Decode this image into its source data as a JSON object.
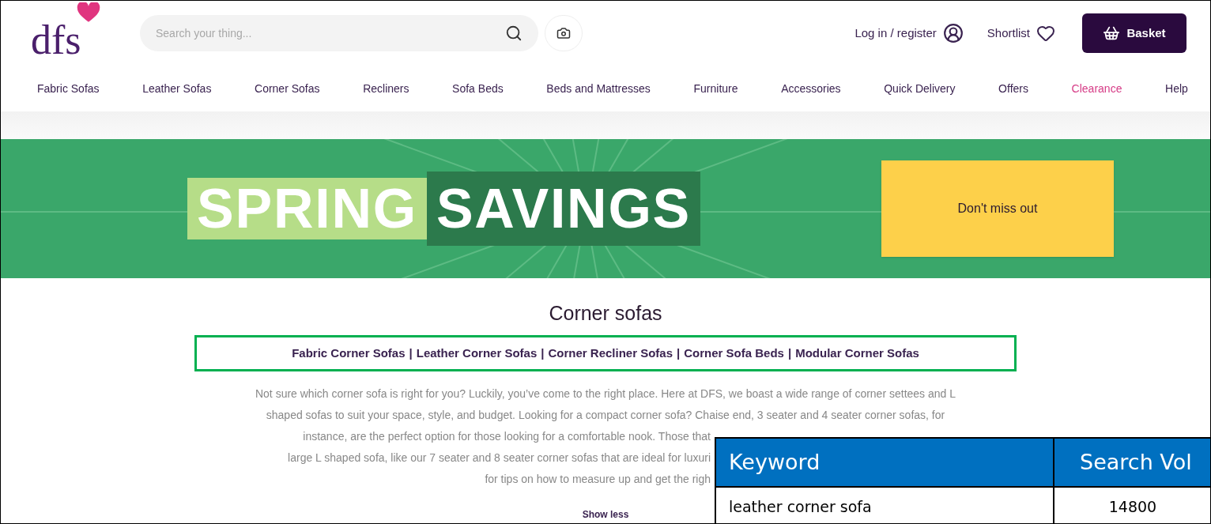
{
  "header": {
    "logo": "dfs",
    "search": {
      "placeholder": "Search your thing..."
    },
    "login": "Log in / register",
    "shortlist": "Shortlist",
    "basket": "Basket"
  },
  "nav": [
    {
      "label": "Fabric Sofas",
      "kind": "normal"
    },
    {
      "label": "Leather Sofas",
      "kind": "normal"
    },
    {
      "label": "Corner Sofas",
      "kind": "normal"
    },
    {
      "label": "Recliners",
      "kind": "normal"
    },
    {
      "label": "Sofa Beds",
      "kind": "normal"
    },
    {
      "label": "Beds and Mattresses",
      "kind": "normal"
    },
    {
      "label": "Furniture",
      "kind": "normal"
    },
    {
      "label": "Accessories",
      "kind": "normal"
    },
    {
      "label": "Quick Delivery",
      "kind": "normal"
    },
    {
      "label": "Offers",
      "kind": "normal"
    },
    {
      "label": "Clearance",
      "kind": "highlight"
    },
    {
      "label": "Help",
      "kind": "normal"
    }
  ],
  "banner": {
    "word_1": "SPRING",
    "word_2": "SAVINGS",
    "button": "Don't miss out"
  },
  "title": "Corner sofas",
  "links": [
    "Fabric Corner Sofas",
    "Leather Corner Sofas",
    "Corner Recliner Sofas",
    "Corner Sofa Beds",
    "Modular Corner Sofas"
  ],
  "separator": "|",
  "paragraph_lines": [
    "Not sure which corner sofa is right for you? Luckily, you’ve come to the right place. Here at DFS, we boast a wide range of corner settees and L",
    "shaped sofas to suit your space, style, and budget. Looking for a compact corner sofa? Chaise end, 3 seater and 4 seater corner sofas, for",
    "instance, are the perfect option for those looking for a comfortable nook. Those that",
    "large L shaped sofa, like our 7 seater and 8 seater corner sofas that are ideal for luxuri",
    "for tips on how to measure up and get the righ"
  ],
  "show_less": "Show less",
  "keyword_table": {
    "columns": [
      "Keyword",
      "Search Vol"
    ],
    "rows": [
      [
        "leather corner sofa",
        "14800"
      ]
    ]
  }
}
